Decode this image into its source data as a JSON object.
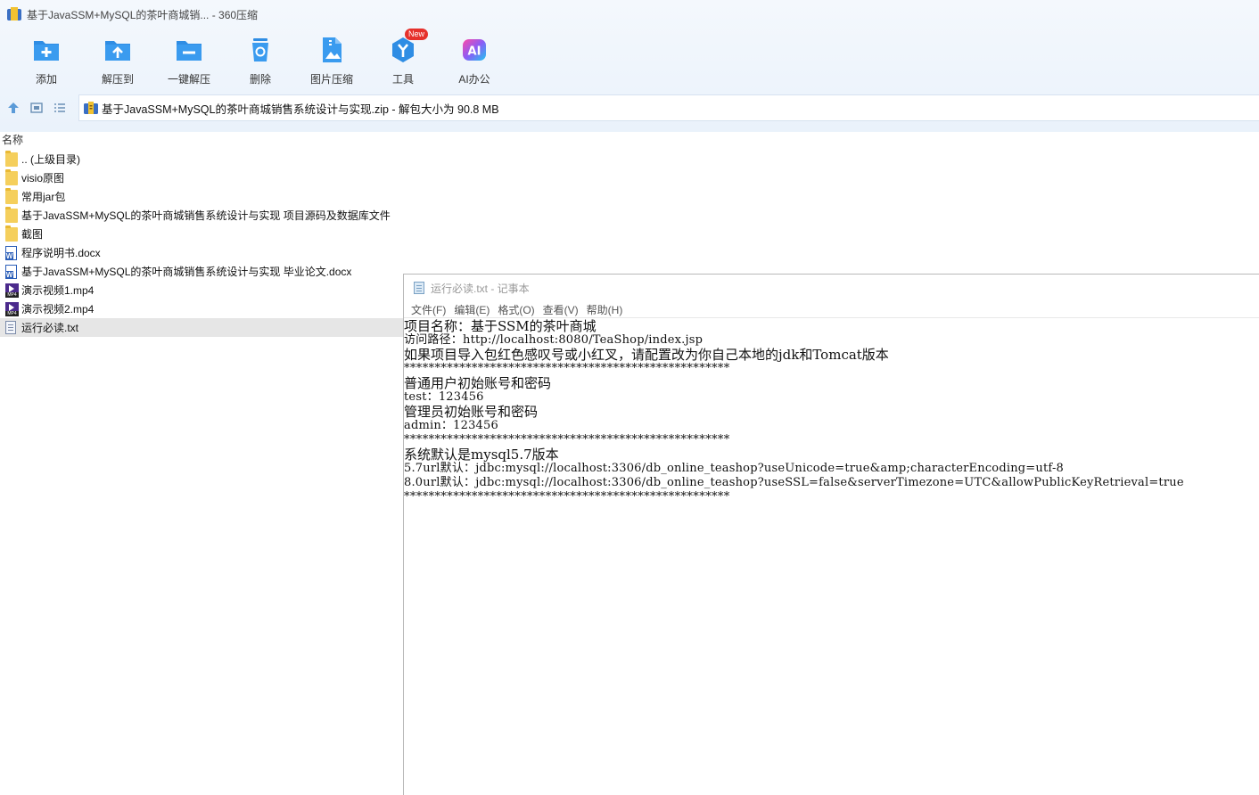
{
  "window": {
    "title": "基于JavaSSM+MySQL的茶叶商城销... - 360压缩",
    "app_icon": "archive-icon"
  },
  "toolbar": {
    "new_badge": "New",
    "buttons": [
      {
        "label": "添加",
        "icon": "add-icon"
      },
      {
        "label": "解压到",
        "icon": "extract-to-icon"
      },
      {
        "label": "一键解压",
        "icon": "one-click-extract-icon"
      },
      {
        "label": "删除",
        "icon": "delete-icon"
      },
      {
        "label": "图片压缩",
        "icon": "image-compress-icon"
      },
      {
        "label": "工具",
        "icon": "tools-icon"
      },
      {
        "label": "AI办公",
        "icon": "ai-office-icon"
      }
    ]
  },
  "address": {
    "text": "基于JavaSSM+MySQL的茶叶商城销售系统设计与实现.zip - 解包大小为 90.8 MB"
  },
  "list": {
    "column_name": "名称",
    "items": [
      {
        "name": ".. (上级目录)",
        "type": "folder"
      },
      {
        "name": "visio原图",
        "type": "folder"
      },
      {
        "name": "常用jar包",
        "type": "folder"
      },
      {
        "name": "基于JavaSSM+MySQL的茶叶商城销售系统设计与实现 项目源码及数据库文件",
        "type": "folder"
      },
      {
        "name": "截图",
        "type": "folder"
      },
      {
        "name": "程序说明书.docx",
        "type": "docx"
      },
      {
        "name": "基于JavaSSM+MySQL的茶叶商城销售系统设计与实现 毕业论文.docx",
        "type": "docx"
      },
      {
        "name": "演示视频1.mp4",
        "type": "mp4"
      },
      {
        "name": "演示视频2.mp4",
        "type": "mp4"
      },
      {
        "name": "运行必读.txt",
        "type": "txt",
        "selected": true
      }
    ]
  },
  "notepad": {
    "title": "运行必读.txt - 记事本",
    "menu": [
      "文件(F)",
      "编辑(E)",
      "格式(O)",
      "查看(V)",
      "帮助(H)"
    ],
    "lines": [
      "项目名称：基于SSM的茶叶商城",
      "访问路径：http://localhost:8080/TeaShop/index.jsp",
      "如果项目导入包红色感叹号或小红叉，请配置改为你自己本地的jdk和Tomcat版本",
      "*****************************************************",
      "普通用户初始账号和密码",
      "test：123456",
      "管理员初始账号和密码",
      "admin：123456",
      "*****************************************************",
      "系统默认是mysql5.7版本",
      "5.7url默认：jdbc:mysql://localhost:3306/db_online_teashop?useUnicode=true&amp;characterEncoding=utf-8",
      "8.0url默认：jdbc:mysql://localhost:3306/db_online_teashop?useSSL=false&serverTimezone=UTC&allowPublicKeyRetrieval=true",
      "*****************************************************"
    ]
  }
}
